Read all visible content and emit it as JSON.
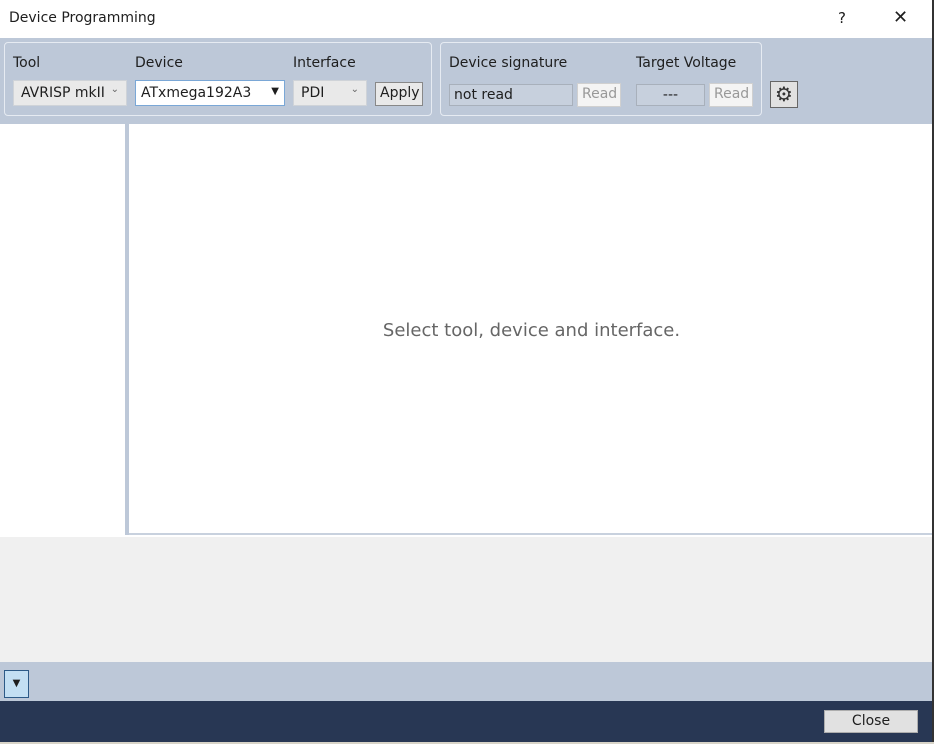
{
  "window": {
    "title": "Device Programming",
    "help": "?",
    "close": "✕"
  },
  "toolbar": {
    "tool_label": "Tool",
    "tool_value": "AVRISP mkII",
    "device_label": "Device",
    "device_value": "ATxmega192A3",
    "interface_label": "Interface",
    "interface_value": "PDI",
    "apply": "Apply",
    "signature_label": "Device signature",
    "signature_value": "not read",
    "signature_read": "Read",
    "voltage_label": "Target Voltage",
    "voltage_value": "---",
    "voltage_read": "Read",
    "settings_icon": "gear-icon"
  },
  "main": {
    "message": "Select tool, device and interface."
  },
  "footer": {
    "close": "Close",
    "expand_icon": "▼"
  }
}
